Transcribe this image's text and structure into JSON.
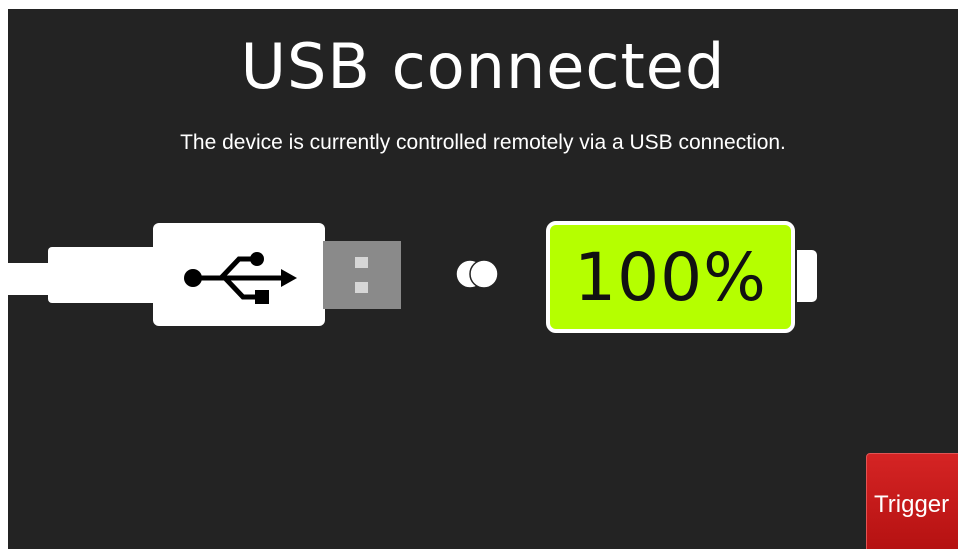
{
  "header": {
    "title": "USB connected",
    "subtitle": "The device is currently controlled remotely via a USB connection."
  },
  "connection": {
    "plug_icon": "usb-trident-icon",
    "link_icon": "connection-dots-icon"
  },
  "battery": {
    "level_percent": 100,
    "label": "100%",
    "fill_color": "#b5ff00"
  },
  "actions": {
    "trigger_label": "Trigger",
    "trigger_color": "#c81a1a"
  },
  "colors": {
    "background": "#232323",
    "foreground": "#ffffff"
  }
}
